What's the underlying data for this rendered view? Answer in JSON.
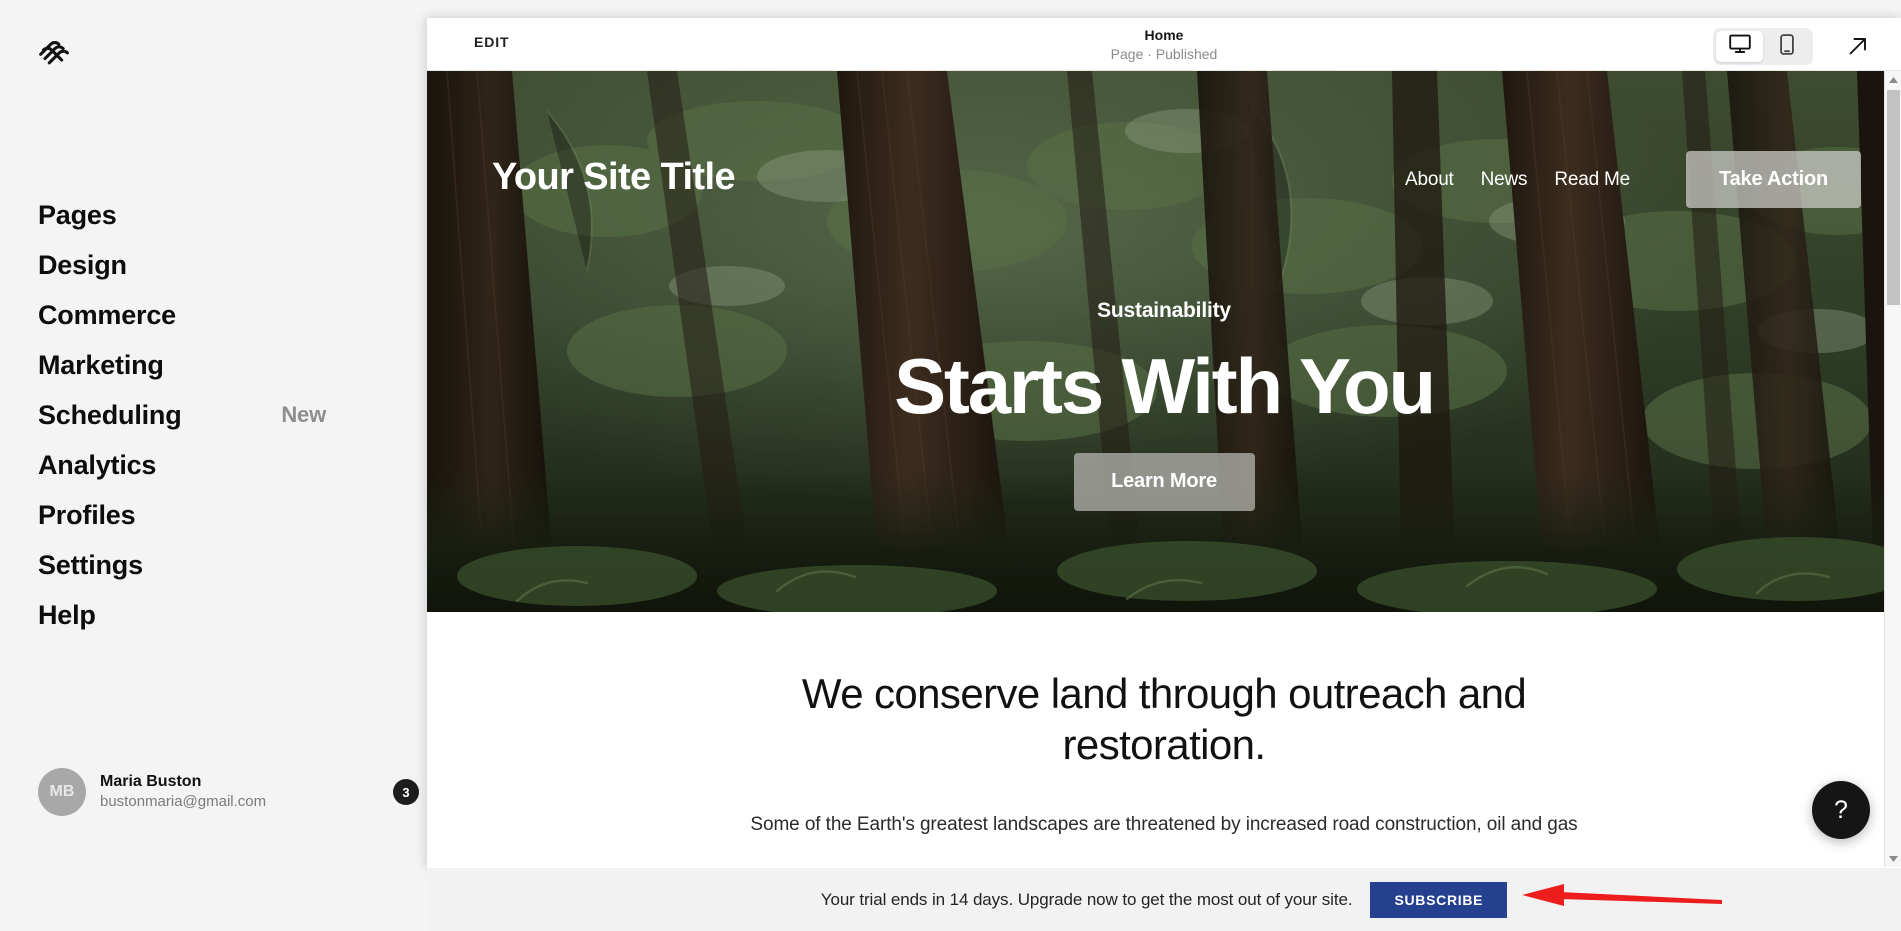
{
  "sidebar": {
    "logo_icon": "squarespace-logo-icon",
    "items": [
      {
        "label": "Pages",
        "badge": ""
      },
      {
        "label": "Design",
        "badge": ""
      },
      {
        "label": "Commerce",
        "badge": ""
      },
      {
        "label": "Marketing",
        "badge": ""
      },
      {
        "label": "Scheduling",
        "badge": "New"
      },
      {
        "label": "Analytics",
        "badge": ""
      },
      {
        "label": "Profiles",
        "badge": ""
      },
      {
        "label": "Settings",
        "badge": ""
      },
      {
        "label": "Help",
        "badge": ""
      }
    ],
    "account": {
      "initials": "MB",
      "name": "Maria Buston",
      "email": "bustonmaria@gmail.com",
      "notification_count": "3"
    }
  },
  "topbar": {
    "edit_label": "EDIT",
    "page_title": "Home",
    "page_status": "Page · Published",
    "desktop_icon": "desktop-monitor-icon",
    "mobile_icon": "mobile-phone-icon",
    "open_icon": "open-external-arrow-icon",
    "active_view": "desktop"
  },
  "site": {
    "title": "Your Site Title",
    "nav": [
      "About",
      "News",
      "Read Me"
    ],
    "cta": "Take Action",
    "hero": {
      "eyebrow": "Sustainability",
      "headline": "Starts With You",
      "button": "Learn More"
    },
    "body": {
      "heading": "We conserve land through outreach and restoration.",
      "paragraph": "Some of the Earth's greatest landscapes are threatened by increased road construction, oil and gas"
    }
  },
  "help": {
    "icon": "question-mark-icon",
    "label": "?"
  },
  "scrollbar": {
    "up_icon": "scroll-up-arrow-icon",
    "down_icon": "scroll-down-arrow-icon"
  },
  "banner": {
    "text": "Your trial ends in 14 days. Upgrade now to get the most out of your site.",
    "subscribe_label": "SUBSCRIBE"
  },
  "annotation": {
    "arrow_color": "#ee1d1d",
    "points_to": "subscribe-button"
  },
  "colors": {
    "app_bg": "#f4f4f4",
    "panel_bg": "#ffffff",
    "accent_blue": "#25408f",
    "badge_dark": "#1d1d1d",
    "muted_text": "#8a8a8a",
    "annotation_red": "#ee1d1d"
  }
}
